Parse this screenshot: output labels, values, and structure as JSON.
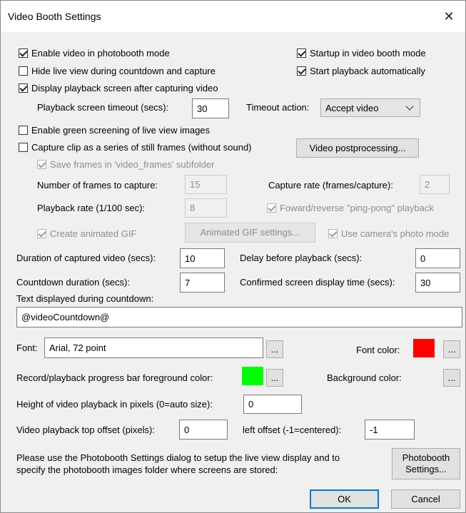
{
  "window": {
    "title": "Video Booth Settings",
    "close_glyph": "✕"
  },
  "checkboxes": {
    "enable_video": {
      "label": "Enable video in photobooth mode",
      "checked": true
    },
    "startup_video": {
      "label": "Startup in video booth mode",
      "checked": true
    },
    "hide_live_view": {
      "label": "Hide live view during countdown and capture",
      "checked": false
    },
    "start_playback": {
      "label": "Start playback automatically",
      "checked": true
    },
    "display_playback": {
      "label": "Display playback screen after capturing video",
      "checked": true
    },
    "green_screen": {
      "label": "Enable green screening of live view images",
      "checked": false
    },
    "capture_frames": {
      "label": "Capture clip as a series of still frames (without sound)",
      "checked": false
    },
    "save_frames": {
      "label": "Save frames in 'video_frames' subfolder",
      "checked": true
    },
    "pingpong": {
      "label": "Foward/reverse \"ping-pong\" playback",
      "checked": true
    },
    "animated_gif": {
      "label": "Create animated GIF",
      "checked": true
    },
    "camera_photo_mode": {
      "label": "Use camera's photo mode",
      "checked": true
    }
  },
  "fields": {
    "playback_timeout": {
      "label": "Playback screen timeout (secs):",
      "value": "30"
    },
    "timeout_action": {
      "label": "Timeout action:",
      "value": "Accept video"
    },
    "num_frames": {
      "label": "Number of frames to capture:",
      "value": "15"
    },
    "capture_rate": {
      "label": "Capture rate (frames/capture):",
      "value": "2"
    },
    "playback_rate": {
      "label": "Playback rate (1/100 sec):",
      "value": "8"
    },
    "duration": {
      "label": "Duration of captured video (secs):",
      "value": "10"
    },
    "delay_playback": {
      "label": "Delay before playback (secs):",
      "value": "0"
    },
    "countdown_duration": {
      "label": "Countdown duration (secs):",
      "value": "7"
    },
    "confirmed_display": {
      "label": "Confirmed screen display time (secs):",
      "value": "30"
    },
    "countdown_text": {
      "label": "Text displayed during countdown:",
      "value": "@videoCountdown@"
    },
    "font": {
      "label": "Font:",
      "value": "Arial, 72 point"
    },
    "font_color": {
      "label": "Font color:",
      "color": "#ff0000"
    },
    "progress_fg": {
      "label": "Record/playback progress bar foreground color:",
      "color": "#00ff00"
    },
    "background_color": {
      "label": "Background color:",
      "color": "#f0f0f0"
    },
    "playback_height": {
      "label": "Height of video playback in pixels (0=auto size):",
      "value": "0"
    },
    "top_offset": {
      "label": "Video playback top offset (pixels):",
      "value": "0"
    },
    "left_offset": {
      "label": "left offset (-1=centered):",
      "value": "-1"
    }
  },
  "buttons": {
    "postprocessing": "Video postprocessing...",
    "gif_settings": "Animated GIF settings...",
    "ellipsis": "...",
    "photobooth_settings_1": "Photobooth",
    "photobooth_settings_2": "Settings...",
    "ok": "OK",
    "cancel": "Cancel"
  },
  "note": {
    "line1": "Please use the Photobooth Settings dialog to setup the live view display and to",
    "line2": "specify the photobooth images folder where screens are stored:"
  },
  "colors": {
    "accent": "#0078d7"
  }
}
